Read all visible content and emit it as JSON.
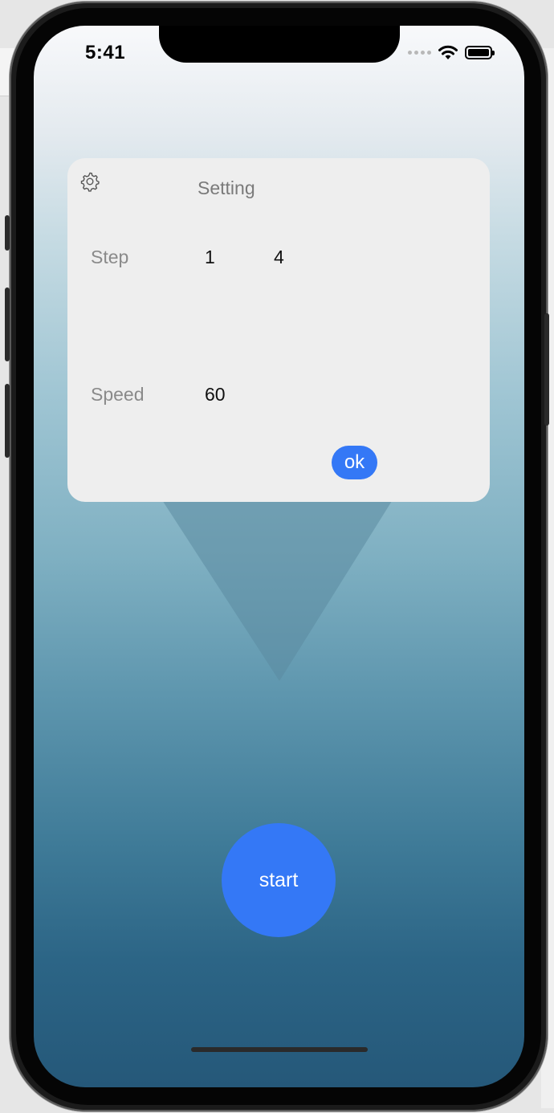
{
  "status_bar": {
    "time": "5:41",
    "icons": [
      "signal-dots-icon",
      "wifi-icon",
      "battery-icon"
    ]
  },
  "settings_card": {
    "icon": "gear-icon",
    "title": "Setting",
    "step": {
      "label": "Step",
      "value_1": "1",
      "value_2": "4"
    },
    "speed": {
      "label": "Speed",
      "value": "60"
    },
    "ok_label": "ok"
  },
  "start_label": "start",
  "colors": {
    "accent": "#3478f6",
    "card_bg": "#eeeeee",
    "gradient_top": "#f8f9fb",
    "gradient_bottom": "#255879"
  }
}
